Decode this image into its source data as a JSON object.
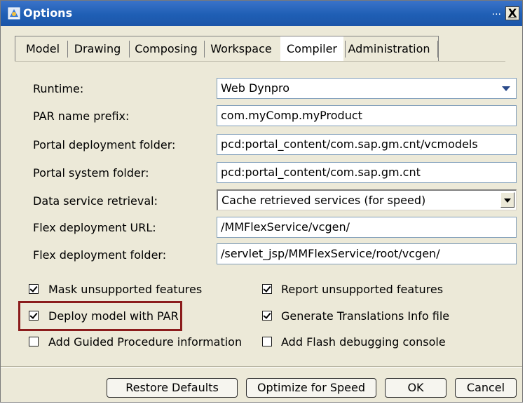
{
  "window": {
    "title": "Options",
    "title_extra": "..."
  },
  "tabs": [
    {
      "label": "Model"
    },
    {
      "label": "Drawing"
    },
    {
      "label": "Composing"
    },
    {
      "label": "Workspace"
    },
    {
      "label": "Compiler",
      "active": true
    },
    {
      "label": "Administration"
    }
  ],
  "fields": {
    "runtime": {
      "label": "Runtime:",
      "value": "Web Dynpro"
    },
    "par_prefix": {
      "label": "PAR name prefix:",
      "value": "com.myComp.myProduct"
    },
    "portal_deploy": {
      "label": "Portal deployment folder:",
      "value": "pcd:portal_content/com.sap.gm.cnt/vcmodels"
    },
    "portal_system": {
      "label": "Portal system folder:",
      "value": "pcd:portal_content/com.sap.gm.cnt"
    },
    "data_service": {
      "label": "Data service retrieval:",
      "value": "Cache retrieved services (for speed)"
    },
    "flex_url": {
      "label": "Flex deployment URL:",
      "value": "/MMFlexService/vcgen/"
    },
    "flex_folder": {
      "label": "Flex deployment folder:",
      "value": "/servlet_jsp/MMFlexService/root/vcgen/"
    }
  },
  "checkboxes": {
    "mask": {
      "label": "Mask unsupported features",
      "checked": true
    },
    "report": {
      "label": "Report unsupported features",
      "checked": true
    },
    "deploy_par": {
      "label": "Deploy model with PAR",
      "checked": true
    },
    "translations": {
      "label": "Generate Translations Info file",
      "checked": true
    },
    "guided": {
      "label": "Add Guided Procedure information",
      "checked": false
    },
    "flash": {
      "label": "Add Flash debugging console",
      "checked": false
    }
  },
  "buttons": {
    "restore": "Restore Defaults",
    "optimize": "Optimize for Speed",
    "ok": "OK",
    "cancel": "Cancel"
  },
  "colors": {
    "titlebar": "#1f5fb5",
    "highlight_box": "#8b1c1c",
    "dialog_bg": "#ece9d8"
  }
}
